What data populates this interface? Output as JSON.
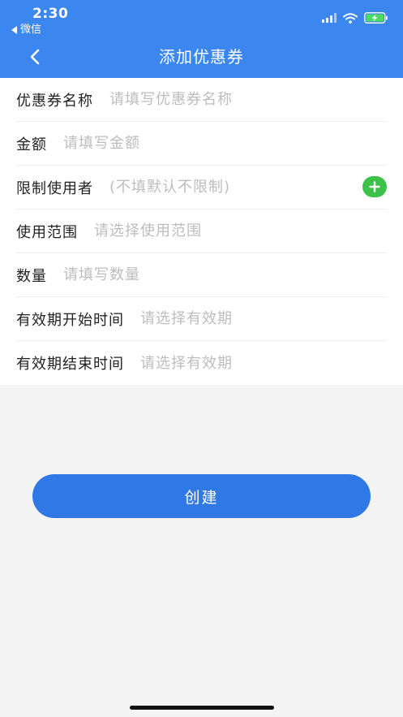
{
  "status_bar": {
    "time": "2:30",
    "back_app": "微信",
    "icons": [
      "cellular-signal-icon",
      "wifi-icon",
      "battery-charging-icon"
    ]
  },
  "nav": {
    "title": "添加优惠券",
    "back_icon": "chevron-left-icon"
  },
  "form": {
    "rows": [
      {
        "label": "优惠券名称",
        "placeholder": "请填写优惠券名称"
      },
      {
        "label": "金额",
        "placeholder": "请填写金额"
      },
      {
        "label": "限制使用者",
        "placeholder": "(不填默认不限制)",
        "action_icon": "plus-circle-icon"
      },
      {
        "label": "使用范围",
        "placeholder": "请选择使用范围"
      },
      {
        "label": "数量",
        "placeholder": "请填写数量"
      },
      {
        "label": "有效期开始时间",
        "placeholder": "请选择有效期"
      },
      {
        "label": "有效期结束时间",
        "placeholder": "请选择有效期"
      }
    ]
  },
  "create_button": {
    "label": "创建"
  },
  "colors": {
    "header": "#3b86ef",
    "button": "#2f78e6",
    "add_button": "#3cc24a",
    "battery": "#4cd964",
    "placeholder": "#bdbdbd",
    "background": "#f4f4f4"
  }
}
